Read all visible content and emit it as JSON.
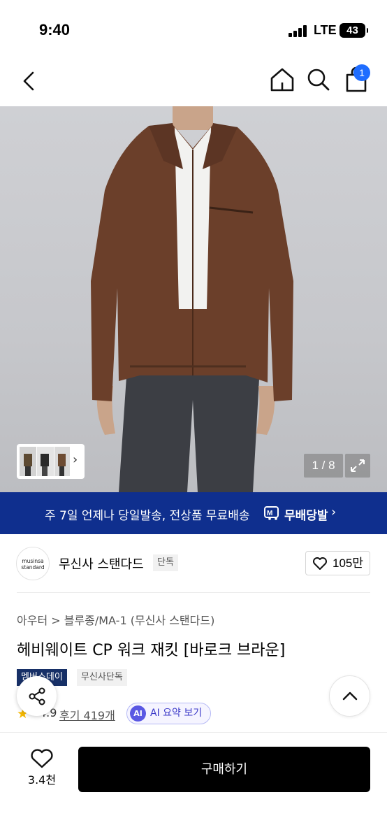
{
  "status_bar": {
    "time": "9:40",
    "network": "LTE",
    "battery": "43"
  },
  "nav": {
    "back_icon": "chevron-left-icon",
    "home_icon": "home-icon",
    "search_icon": "search-icon",
    "cart_icon": "shopping-bag-icon",
    "cart_count": "1"
  },
  "gallery": {
    "counter": "1 / 8",
    "thumbs_icon": "chevron-right-icon",
    "expand_icon": "expand-icon"
  },
  "delivery_banner": {
    "text": "주 7일 언제나 당일발송, 전상품 무료배송",
    "logo_text": "무배당발",
    "chevron": "›"
  },
  "brand": {
    "logo_text_top": "musinsa",
    "logo_text_bottom": "standard",
    "name": "무신사 스탠다드",
    "tag": "단독",
    "likes": "105만"
  },
  "product": {
    "breadcrumb": "아우터 > 블루종/MA-1 (무신사 스탠다드)",
    "title": "헤비웨이트 CP 워크 재킷 [바로크 브라운]",
    "badge_member": "멤버스데이",
    "badge_exclusive": "무신사단독",
    "rating": "4.9",
    "reviews": "후기 419개",
    "ai_icon": "AI",
    "ai_summary": "AI 요약 보기"
  },
  "bottom_bar": {
    "wish_count": "3.4천",
    "buy_label": "구매하기"
  },
  "colors": {
    "brand_blue": "#0f2f8e",
    "badge_blue": "#1f6dff",
    "buy_black": "#000000",
    "jacket_brown": "#6b3f2a"
  }
}
